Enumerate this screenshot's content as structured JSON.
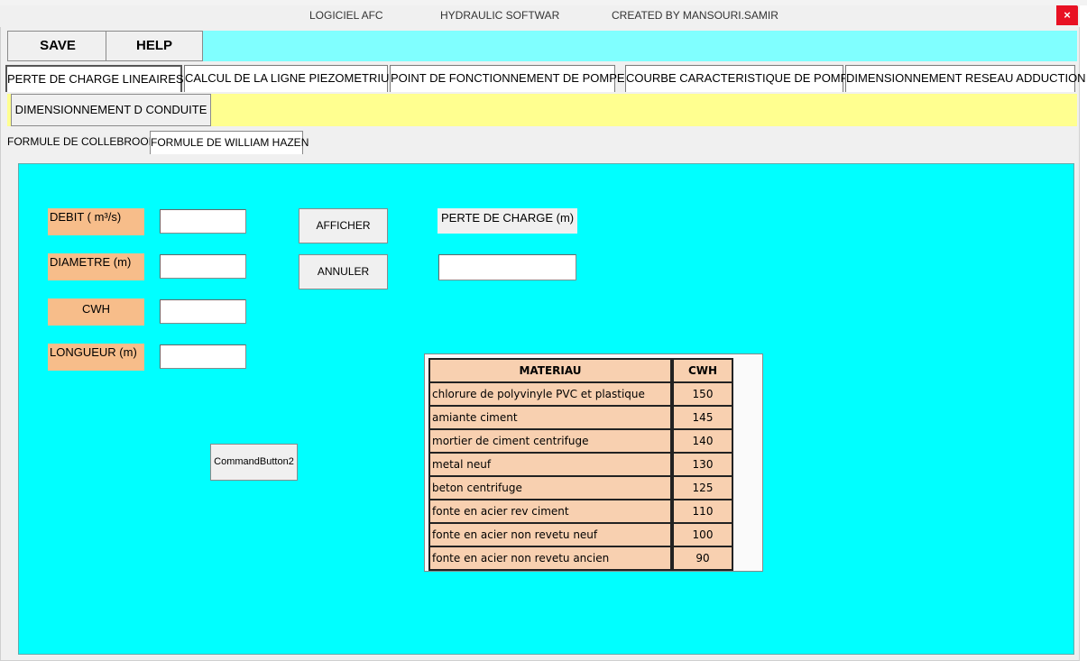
{
  "window": {
    "title_app": "LOGICIEL AFC",
    "title_software": "HYDRAULIC SOFTWAR",
    "title_author": "CREATED  BY  MANSOURI.SAMIR",
    "close_glyph": "×"
  },
  "toolbar": {
    "save_label": "SAVE",
    "help_label": "HELP"
  },
  "tabs": [
    {
      "label": "PERTE DE CHARGE LINEAIRES",
      "active": true
    },
    {
      "label": "CALCUL DE LA LIGNE PIEZOMETRIUE"
    },
    {
      "label": "POINT DE FONCTIONNEMENT DE POMPE"
    },
    {
      "label": "COURBE CARACTERISTIQUE DE POMPE"
    },
    {
      "label": "DIMENSIONNEMENT RESEAU ADDUCTION"
    }
  ],
  "dim_button": "DIMENSIONNEMENT D CONDUITE",
  "subtabs": [
    {
      "label": "FORMULE DE COLLEBROOK"
    },
    {
      "label": "FORMULE DE WILLIAM HAZEN",
      "active": true
    }
  ],
  "form": {
    "debit_label": "DEBIT  ( m³/s)",
    "diametre_label": "DIAMETRE  (m)",
    "cwh_label": "CWH",
    "longueur_label": "LONGUEUR  (m)",
    "debit_value": "",
    "diametre_value": "",
    "cwh_value": "",
    "longueur_value": "",
    "afficher_label": "AFFICHER",
    "annuler_label": "ANNULER",
    "perte_label": "PERTE  DE  CHARGE  (m)",
    "perte_value": "",
    "command_button_label": "CommandButton2"
  },
  "materials": {
    "header_material": "MATERIAU",
    "header_cwh": "CWH",
    "rows": [
      {
        "name": "chlorure de polyvinyle PVC et plastique",
        "cwh": "150"
      },
      {
        "name": "amiante ciment",
        "cwh": "145"
      },
      {
        "name": "mortier de ciment centrifuge",
        "cwh": "140"
      },
      {
        "name": "metal neuf",
        "cwh": "130"
      },
      {
        "name": "beton centrifuge",
        "cwh": "125"
      },
      {
        "name": "fonte en acier rev ciment",
        "cwh": "110"
      },
      {
        "name": "fonte en acier non revetu neuf",
        "cwh": "100"
      },
      {
        "name": "fonte en acier non revetu ancien",
        "cwh": "90"
      }
    ]
  },
  "colors": {
    "cyan_area": "#00ffff",
    "top_bar": "#80ffff",
    "yellow_strip": "#ffff90",
    "label_bg": "#f7bd8a",
    "table_cell": "#f8d0b0",
    "close": "#e81123"
  }
}
